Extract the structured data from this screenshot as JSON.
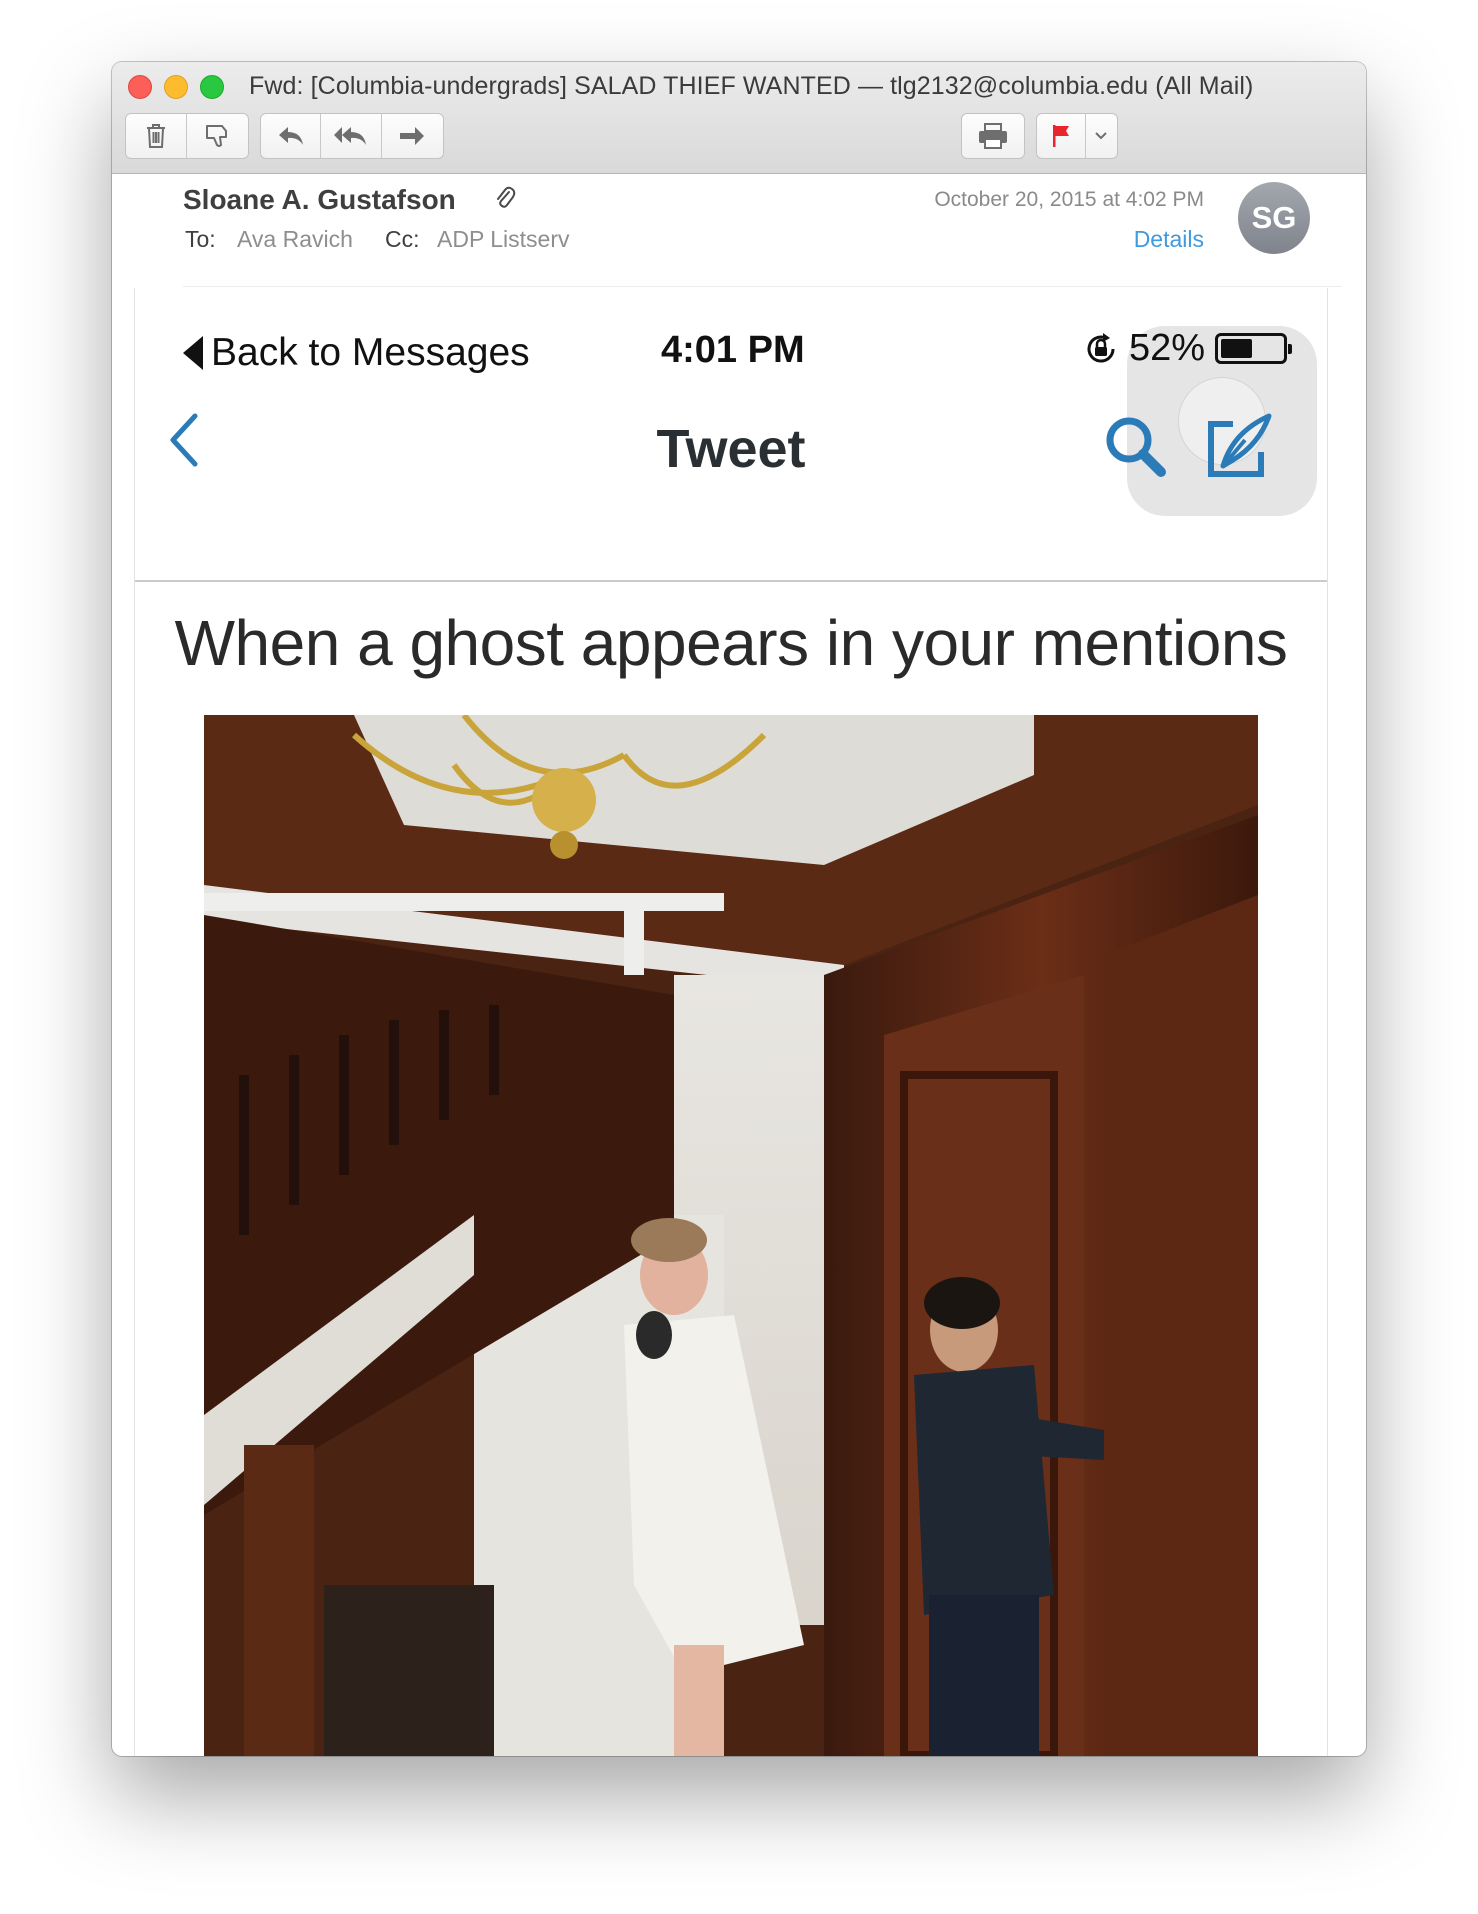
{
  "window": {
    "title": "Fwd: [Columbia-undergrads] SALAD THIEF WANTED — tlg2132@columbia.edu (All Mail)"
  },
  "toolbar": {
    "icons": [
      "trash-icon",
      "junk-icon",
      "reply-icon",
      "reply-all-icon",
      "forward-icon",
      "print-icon",
      "flag-icon",
      "chevron-down-icon"
    ],
    "flag_color": "#e8262b"
  },
  "message": {
    "sender": "Sloane A. Gustafson",
    "to_label": "To:",
    "to": "Ava Ravich",
    "cc_label": "Cc:",
    "cc": "ADP Listserv",
    "date": "October 20, 2015 at 4:02 PM",
    "details_link": "Details",
    "avatar_initials": "SG"
  },
  "phone": {
    "status_back": "Back to Messages",
    "time": "4:01 PM",
    "battery": "52%",
    "battery_level": 0.52,
    "nav_title": "Tweet",
    "tweet_text": "When a ghost appears in your mentions",
    "accent": "#2b7bb9"
  }
}
